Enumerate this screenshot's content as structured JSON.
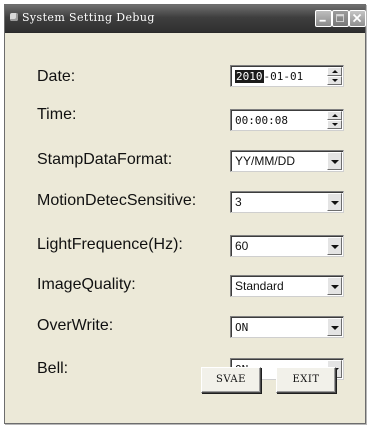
{
  "window": {
    "title": "System Setting Debug"
  },
  "fields": {
    "date": {
      "label": "Date:",
      "year": "2010",
      "rest": "-01-01"
    },
    "time": {
      "label": "Time:",
      "value": "00:00:08"
    },
    "stamp_format": {
      "label": "StampDataFormat:",
      "value": "YY/MM/DD"
    },
    "motion": {
      "label": "MotionDetecSensitive:",
      "value": "3"
    },
    "light": {
      "label": "LightFrequence(Hz):",
      "value": "60"
    },
    "quality": {
      "label": "ImageQuality:",
      "value": "Standard"
    },
    "overwrite": {
      "label": "OverWrite:",
      "value": "ON"
    },
    "bell": {
      "label": "Bell:",
      "value": "ON"
    }
  },
  "buttons": {
    "save_label": "SVAE",
    "exit_label": "EXIT"
  },
  "icons": {
    "app": "app-icon",
    "minimize": "minimize-icon",
    "maximize": "maximize-icon",
    "close": "close-icon",
    "dropdown": "chevron-down-icon",
    "spin_up": "spin-up-icon",
    "spin_down": "spin-down-icon"
  }
}
